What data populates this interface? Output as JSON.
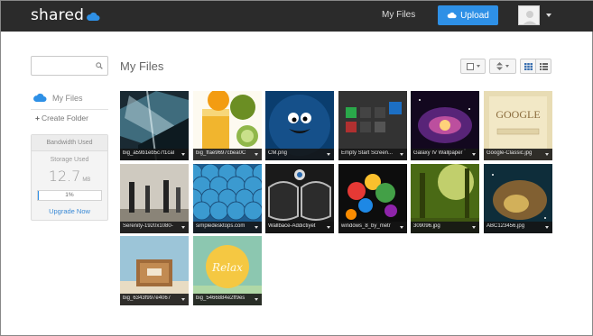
{
  "app": {
    "logo_text": "shared",
    "brand_color": "#2e90e6"
  },
  "header": {
    "nav_myfiles": "My Files",
    "upload_label": "Upload"
  },
  "sidebar": {
    "search_placeholder": "",
    "myfiles_label": "My Files",
    "create_folder_label": "Create Folder",
    "bandwidth": {
      "title": "Bandwidth Used",
      "storage_label": "Storage Used",
      "storage_value": "12.7",
      "storage_unit": "MB",
      "progress_text": "1%",
      "progress_fraction": 0.01,
      "upgrade_label": "Upgrade Now"
    }
  },
  "main": {
    "title": "My Files",
    "files": [
      {
        "name": "big_a59b1eb5c7f1cal",
        "theme": "dark-crystal"
      },
      {
        "name": "big_ffae9697cbea0C",
        "theme": "fruit"
      },
      {
        "name": "CM.png",
        "theme": "cookie-monster"
      },
      {
        "name": "Empty Start Screen...",
        "theme": "start-screen"
      },
      {
        "name": "Galaxy IV Wallpaper",
        "theme": "galaxy"
      },
      {
        "name": "Google-Classic.jpg",
        "theme": "google"
      },
      {
        "name": "Serenity-1920x1080-",
        "theme": "serenity"
      },
      {
        "name": "simpledesktops.com",
        "theme": "scales"
      },
      {
        "name": "Wallbace-Addictiyet",
        "theme": "bmw"
      },
      {
        "name": "windows_8_by_metr",
        "theme": "win8"
      },
      {
        "name": "309096.jpg",
        "theme": "forest"
      },
      {
        "name": "ABC123456.jpg",
        "theme": "nebula"
      },
      {
        "name": "big_6343f997e4067",
        "theme": "beach-chair"
      },
      {
        "name": "big_5466884e2ff9es",
        "theme": "relax"
      }
    ]
  }
}
